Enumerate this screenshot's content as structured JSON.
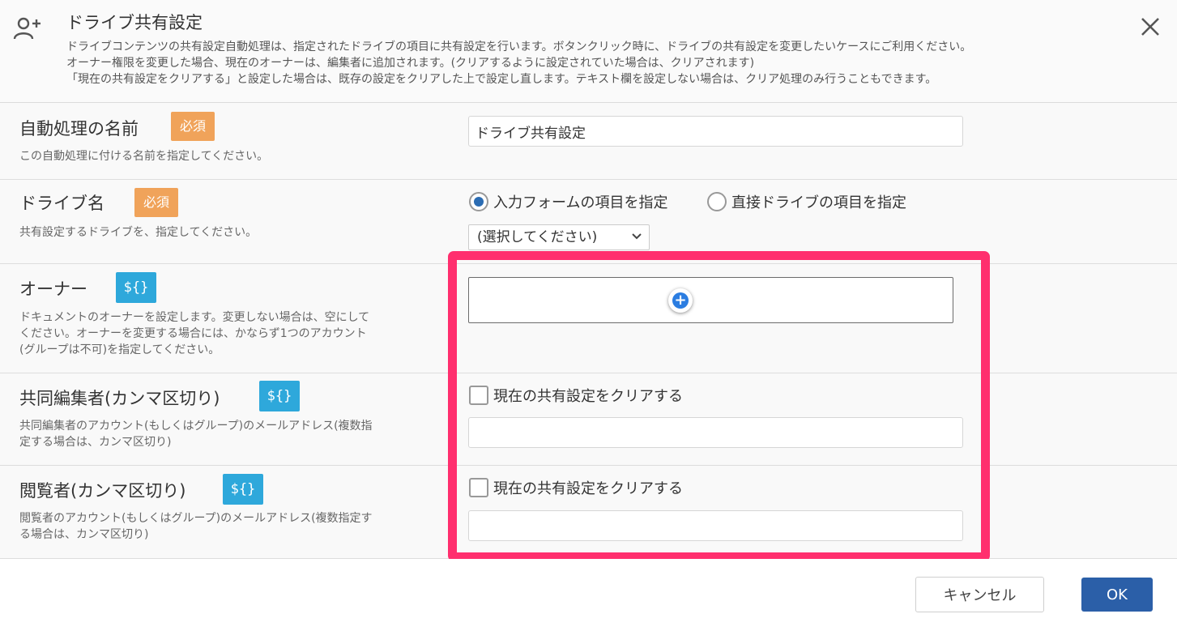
{
  "dialog": {
    "title": "ドライブ共有設定",
    "description": [
      "ドライブコンテンツの共有設定自動処理は、指定されたドライブの項目に共有設定を行います。ボタンクリック時に、ドライブの共有設定を変更したいケースにご利用ください。",
      "オーナー権限を変更した場合、現在のオーナーは、編集者に追加されます。(クリアするように設定されていた場合は、クリアされます)",
      "「現在の共有設定をクリアする」と設定した場合は、既存の設定をクリアした上で設定し直します。テキスト欄を設定しない場合は、クリア処理のみ行うこともできます。"
    ],
    "icons": {
      "header": "add-user-icon",
      "close": "close-icon"
    }
  },
  "required_label": "必須",
  "variable_label": "${}",
  "fields": {
    "name": {
      "label": "自動処理の名前",
      "help": "この自動処理に付ける名前を指定してください。",
      "value": "ドライブ共有設定"
    },
    "drive": {
      "label": "ドライブ名",
      "help": "共有設定するドライブを、指定してください。",
      "radio_form": "入力フォームの項目を指定",
      "radio_direct": "直接ドライブの項目を指定",
      "selected_radio": "form",
      "select_value": "(選択してください)"
    },
    "owner": {
      "label": "オーナー",
      "help": [
        "ドキュメントのオーナーを設定します。変更しない場合は、空にして",
        "ください。オーナーを変更する場合には、かならず1つのアカウント",
        "(グループは不可)を指定してください。"
      ]
    },
    "editors": {
      "label": "共同編集者(カンマ区切り)",
      "help": [
        "共同編集者のアカウント(もしくはグループ)のメールアドレス(複数指",
        "定する場合は、カンマ区切り)"
      ],
      "clear_label": "現在の共有設定をクリアする",
      "value": ""
    },
    "viewers": {
      "label": "閲覧者(カンマ区切り)",
      "help": [
        "閲覧者のアカウント(もしくはグループ)のメールアドレス(複数指定す",
        "る場合は、カンマ区切り)"
      ],
      "clear_label": "現在の共有設定をクリアする",
      "value": ""
    }
  },
  "buttons": {
    "cancel": "キャンセル",
    "ok": "OK"
  },
  "colors": {
    "highlight": "#ff2f6e",
    "required_badge": "#f0a35a",
    "variable_badge": "#2ea8db",
    "ok_button": "#2b5fa8"
  }
}
